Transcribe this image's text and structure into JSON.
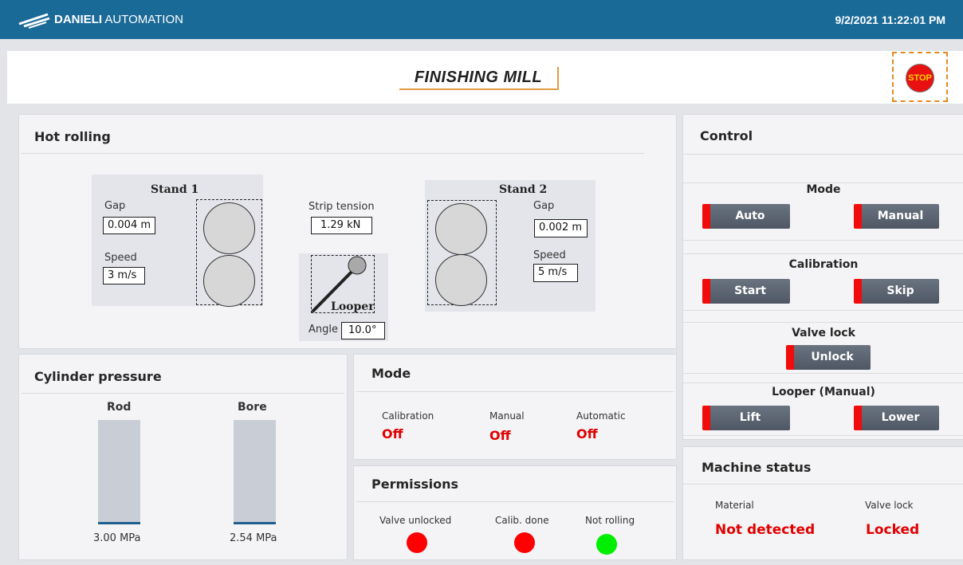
{
  "header": {
    "brand_bold": "DANIELI",
    "brand_rest": " AUTOMATION",
    "datetime": "9/2/2021 11:22:01 PM"
  },
  "title": "FINISHING MILL",
  "stop_label": "STOP",
  "hot_rolling": {
    "title": "Hot rolling",
    "stand1": {
      "title": "Stand 1",
      "gap_label": "Gap",
      "gap_value": "0.004 m",
      "speed_label": "Speed",
      "speed_value": "3 m/s"
    },
    "stand2": {
      "title": "Stand 2",
      "gap_label": "Gap",
      "gap_value": "0.002 m",
      "speed_label": "Speed",
      "speed_value": "5 m/s"
    },
    "strip_tension_label": "Strip tension",
    "strip_tension_value": "1.29 kN",
    "looper_label": "Looper",
    "angle_label": "Angle",
    "angle_value": "10.0°"
  },
  "cylinder_pressure": {
    "title": "Cylinder pressure",
    "rod": {
      "label": "Rod",
      "value": "3.00 MPa",
      "fill_fraction": 0.02
    },
    "bore": {
      "label": "Bore",
      "value": "2.54 MPa",
      "fill_fraction": 0.02
    }
  },
  "mode_panel": {
    "title": "Mode",
    "items": [
      {
        "label": "Calibration",
        "state": "Off"
      },
      {
        "label": "Manual",
        "state": "Off"
      },
      {
        "label": "Automatic",
        "state": "Off"
      }
    ]
  },
  "permissions": {
    "title": "Permissions",
    "items": [
      {
        "label": "Valve unlocked",
        "color": "#ff0000"
      },
      {
        "label": "Calib. done",
        "color": "#ff0000"
      },
      {
        "label": "Not rolling",
        "color": "#00ee00"
      }
    ]
  },
  "control": {
    "title": "Control",
    "mode": {
      "title": "Mode",
      "auto": "Auto",
      "manual": "Manual"
    },
    "calibration": {
      "title": "Calibration",
      "start": "Start",
      "skip": "Skip"
    },
    "valve_lock": {
      "title": "Valve lock",
      "unlock": "Unlock"
    },
    "looper": {
      "title": "Looper (Manual)",
      "lift": "Lift",
      "lower": "Lower"
    }
  },
  "machine_status": {
    "title": "Machine status",
    "material_label": "Material",
    "material_value": "Not detected",
    "valve_lock_label": "Valve lock",
    "valve_lock_value": "Locked"
  },
  "colors": {
    "header_bg": "#1a6a98",
    "alarm_red": "#e00000",
    "button_indicator": "#f10b0b",
    "stop_red": "#e81010"
  }
}
